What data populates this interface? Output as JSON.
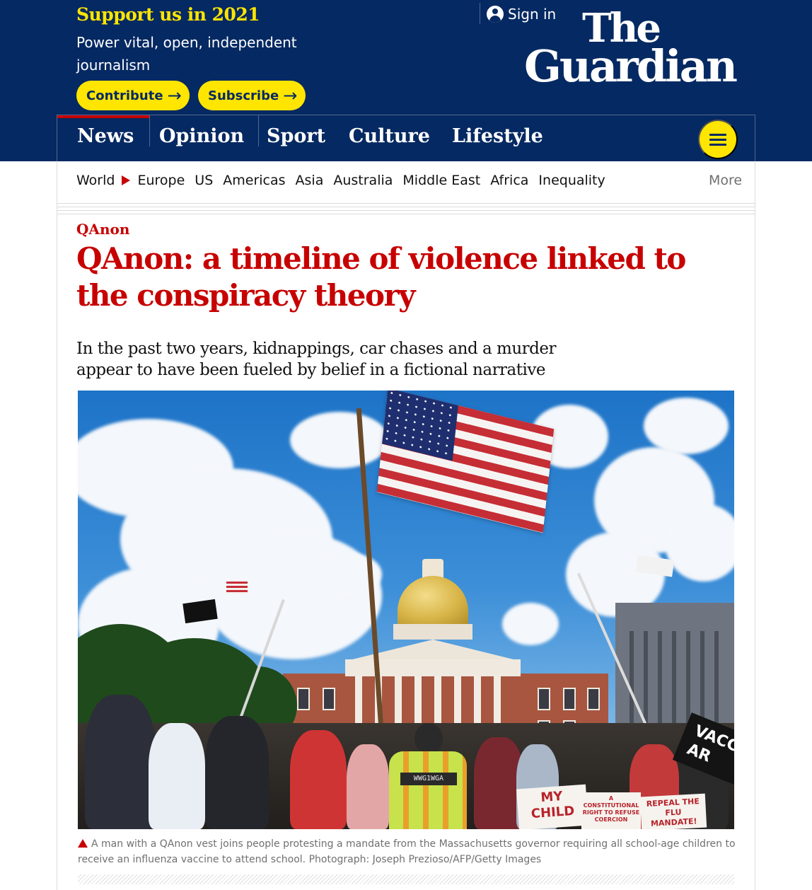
{
  "header": {
    "support_title": "Support us in 2021",
    "support_sub": "Power vital, open, independent journalism",
    "contribute_label": "Contribute",
    "subscribe_label": "Subscribe",
    "arrow_glyph": "→",
    "signin_label": "Sign in",
    "logo_line1": "The",
    "logo_line2": "Guardian",
    "brand_color": "#052962",
    "accent_color": "#ffe500"
  },
  "pillars": {
    "active": "News",
    "items": [
      {
        "label": "News"
      },
      {
        "label": "Opinion"
      },
      {
        "label": "Sport"
      },
      {
        "label": "Culture"
      },
      {
        "label": "Lifestyle"
      }
    ],
    "menu_icon": "hamburger-icon"
  },
  "subnav": {
    "items": [
      {
        "label": "World"
      },
      {
        "label": "Europe"
      },
      {
        "label": "US"
      },
      {
        "label": "Americas"
      },
      {
        "label": "Asia"
      },
      {
        "label": "Australia"
      },
      {
        "label": "Middle East"
      },
      {
        "label": "Africa"
      },
      {
        "label": "Inequality"
      }
    ],
    "more_label": "More"
  },
  "article": {
    "kicker": "QAnon",
    "headline": "QAnon: a timeline of violence linked to the conspiracy theory",
    "standfirst": "In the past two years, kidnappings, car chases and a murder appear to have been fueled by belief in a fictional narrative",
    "news_color": "#c70000",
    "caption": "A man with a QAnon vest joins people protesting a mandate from the Massachusetts governor requiring all school-age children to receive an influenza vaccine to attend school. Photograph: Joseph Prezioso/AFP/Getty Images"
  },
  "photo_signs": {
    "sign_child": "MY CHILD",
    "sign_repeal": "REPEAL THE FLU MANDATE!",
    "sign_constitutional": "A CONSTITUTIONAL RIGHT TO REFUSE COERCION",
    "sign_vacc": "VACC AR",
    "vest_text": "WWG1WGA"
  }
}
